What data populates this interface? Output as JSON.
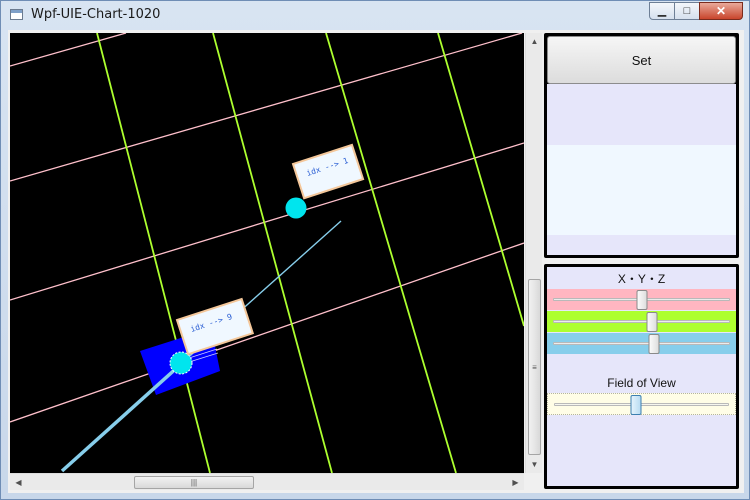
{
  "window": {
    "title": "Wpf-UIE-Chart-1020",
    "minimize_glyph": "▁",
    "maximize_glyph": "□",
    "close_glyph": "✕"
  },
  "scene": {
    "labels": [
      {
        "text": "idx --> 1"
      },
      {
        "text": "idx --> 9"
      }
    ]
  },
  "panel": {
    "set_label": "Set",
    "axes_label": "X・Y・Z",
    "fov_label": "Field of View",
    "sliders": {
      "x": {
        "value": 0.5,
        "color": "#ffb6c1"
      },
      "y": {
        "value": 0.56,
        "color": "#adff2f"
      },
      "z": {
        "value": 0.57,
        "color": "#87ceeb"
      },
      "fov": {
        "value": 0.47
      }
    },
    "colors": {
      "lavender": "#e6e6fa",
      "alice_blue": "#f0f8ff",
      "fov_background": "#fffde6"
    }
  },
  "scroll": {
    "vertical_grip": "≡",
    "horizontal_grip": "|||"
  }
}
